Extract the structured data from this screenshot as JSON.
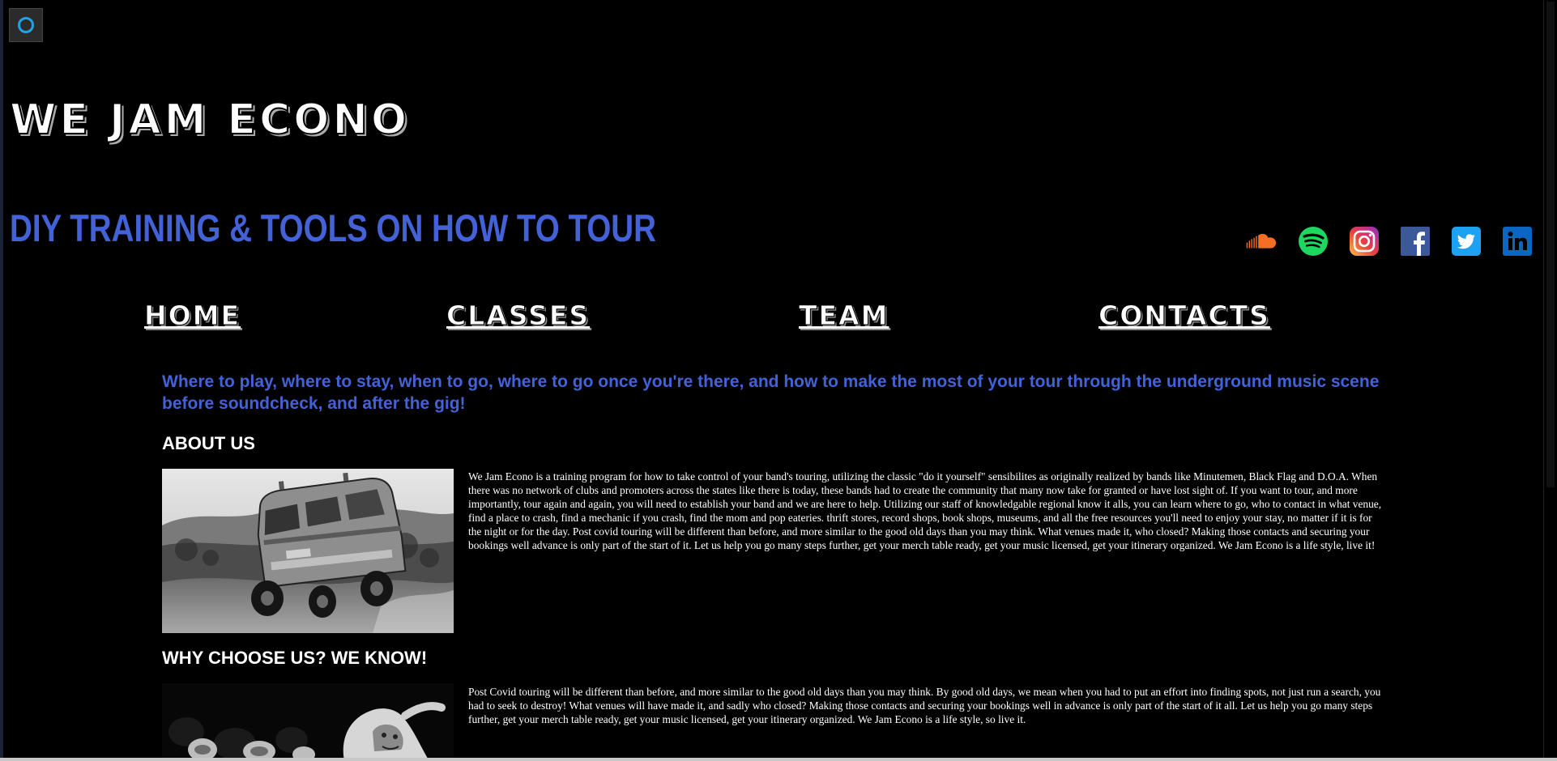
{
  "site": {
    "title": "WE JAM ECONO",
    "tagline": "DIY TRAINING & TOOLS ON HOW TO TOUR"
  },
  "social": [
    {
      "name": "soundcloud",
      "icon": "soundcloud-icon",
      "color": "#f26f23"
    },
    {
      "name": "spotify",
      "icon": "spotify-icon",
      "color": "#1ed760"
    },
    {
      "name": "instagram",
      "icon": "instagram-icon",
      "color": "#e1306c"
    },
    {
      "name": "facebook",
      "icon": "facebook-icon",
      "color": "#3b5998"
    },
    {
      "name": "twitter",
      "icon": "twitter-icon",
      "color": "#1da1f2"
    },
    {
      "name": "linkedin",
      "icon": "linkedin-icon",
      "color": "#0a66c2"
    }
  ],
  "nav": {
    "items": [
      {
        "label": "HOME"
      },
      {
        "label": "CLASSES"
      },
      {
        "label": "TEAM"
      },
      {
        "label": "CONTACTS"
      }
    ]
  },
  "intro": "Where to play, where to stay, when to go, where to go once you're there, and how to make the most of your tour through the underground music scene before soundcheck, and after the gig!",
  "sections": [
    {
      "heading": "ABOUT US",
      "image": "van-photo",
      "text": "We Jam Econo is a training program for how to take control of your band's touring, utilizing the classic \"do it yourself\" sensibilites as originally realized by bands like Minutemen, Black Flag and D.O.A. When there was no network of clubs and promoters across the states like there is today, these bands had to create the community that many now take for granted or have lost sight of. If you want to tour, and more importantly, tour again and again, you will need to establish your band and we are here to help. Utilizing our staff of knowledgable regional know it alls, you can learn where to go, who to contact in what venue, find a place to crash, find a mechanic if you crash, find the mom and pop eateries. thrift stores, record shops, book shops, museums, and all the free resources you'll need to enjoy your stay, no matter if it is for the night or for the day. Post covid touring will be different than before, and more similar to the good old days than you may think. What venues made it, who closed? Making those contacts and securing your bookings well advance is only part of the start of it. Let us help you go many steps further, get your merch table ready, get your music licensed, get your itinerary organized. We Jam Econo is a life style, live it!"
    },
    {
      "heading": "WHY CHOOSE US? WE KNOW!",
      "image": "crowd-photo",
      "text": "Post Covid touring will be different than before, and more similar to the good old days than you may think. By good old days, we mean when you had to put an effort into finding spots, not just run a search, you had to seek to destroy! What venues will have made it, and sadly who closed? Making those contacts and securing your bookings well in advance is only part of the start of it all. Let us help you go many steps further, get your merch table ready, get your music licensed, get your itinerary organized. We Jam Econo is a life style, so live it."
    }
  ],
  "colors": {
    "background": "#000000",
    "accent_blue": "#4462d8",
    "text": "#ffffff"
  }
}
